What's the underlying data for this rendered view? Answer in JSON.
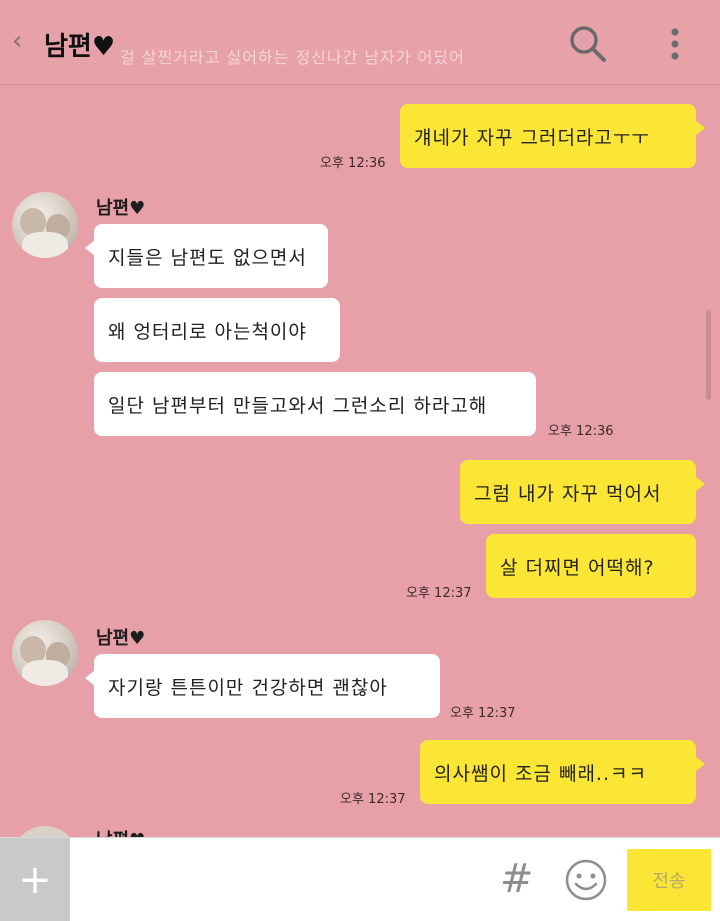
{
  "header": {
    "back_icon": "chevron-left-icon",
    "title": "남편♥",
    "ghost_text": "걸 살찐거라고 싫어하는 정신나간 남자가 어딨어",
    "search_icon": "search-icon",
    "more_icon": "more-vertical-icon"
  },
  "messages": [
    {
      "text": "걔네가 자꾸 그러더라고ㅜㅜ",
      "time": "오후 12:36"
    },
    {
      "name": "남편♥"
    },
    {
      "text": "지들은 남편도 없으면서"
    },
    {
      "text": "왜 엉터리로 아는척이야"
    },
    {
      "text": "일단 남편부터 만들고와서 그런소리 하라고해",
      "time": "오후 12:36"
    },
    {
      "text": "그럼 내가 자꾸 먹어서"
    },
    {
      "text": "살 더찌면 어떡해?",
      "time": "오후 12:37"
    },
    {
      "name": "남편♥"
    },
    {
      "text": "자기랑 튼튼이만 건강하면 괜찮아",
      "time": "오후 12:37"
    },
    {
      "text": "의사쌤이 조금 빼래..ㅋㅋ",
      "time": "오후 12:37"
    },
    {
      "name": "남편♥"
    }
  ],
  "input_bar": {
    "plus_label": "+",
    "hash_label": "#",
    "emoji_icon": "smiley-icon",
    "send_label": "전송"
  },
  "colors": {
    "background": "#e8a0a8",
    "my_bubble": "#fbe535",
    "partner_bubble": "#ffffff"
  }
}
